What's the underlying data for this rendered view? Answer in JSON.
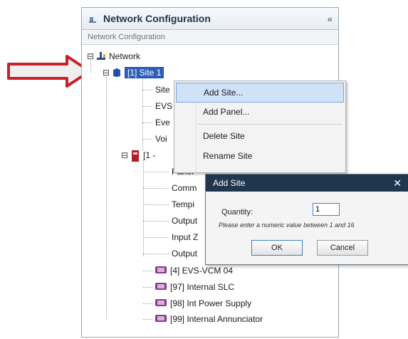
{
  "panel": {
    "title": "Network Configuration",
    "collapse_glyph": "«",
    "subtitle": "Network Configuration"
  },
  "tree": {
    "root": {
      "label": "Network",
      "expander": "⊟",
      "icon": "network-icon"
    },
    "site": {
      "label": "[1] Site 1",
      "expander": "⊟",
      "icon": "site-icon"
    },
    "site_children": [
      "Site",
      "EVS",
      "Eve",
      "Voi"
    ],
    "panel_node": {
      "label": "[1 -",
      "expander": "⊟",
      "icon": "panel-icon"
    },
    "panel_children": [
      "Panel",
      "Comm",
      "Tempi",
      "Output",
      "Input Z",
      "Output"
    ],
    "modules": [
      {
        "label": "[4] EVS-VCM 04",
        "icon": "module-icon"
      },
      {
        "label": "[97] Internal SLC",
        "icon": "module-icon"
      },
      {
        "label": "[98] Int Power Supply",
        "icon": "module-icon"
      },
      {
        "label": "[99] Internal Annunciator",
        "icon": "module-icon"
      }
    ]
  },
  "context_menu": {
    "items": [
      {
        "label": "Add Site...",
        "highlighted": true
      },
      {
        "label": "Add Panel..."
      },
      {
        "label": "Delete Site"
      },
      {
        "label": "Rename Site"
      }
    ]
  },
  "dialog": {
    "title": "Add Site",
    "close_glyph": "✕",
    "quantity_label": "Quantity:",
    "quantity_value": "1",
    "hint": "Please enter a numeric value between 1 and 16",
    "ok_label": "OK",
    "cancel_label": "Cancel"
  },
  "colors": {
    "callout_arrow": "#c8202a",
    "selection": "#2d5fba",
    "dialog_title_bar": "#20364d",
    "menu_highlight": "#cfe2f7"
  }
}
